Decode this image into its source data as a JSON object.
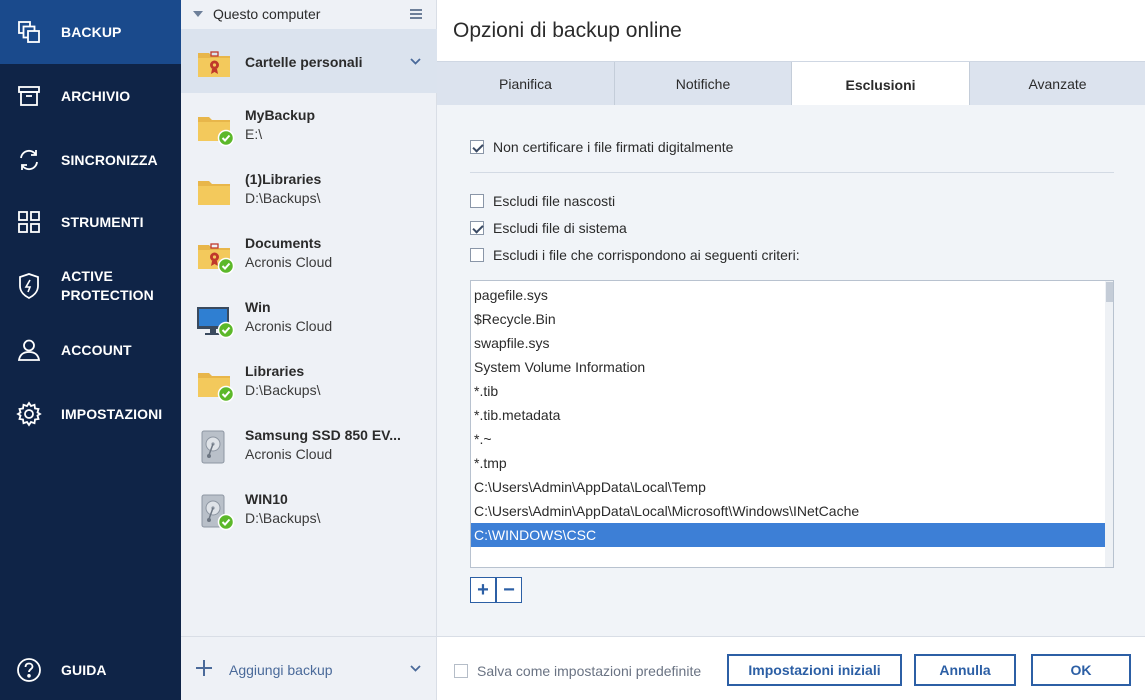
{
  "nav": {
    "items": [
      {
        "label": "BACKUP",
        "icon": "backup-icon"
      },
      {
        "label": "ARCHIVIO",
        "icon": "archive-icon"
      },
      {
        "label": "SINCRONIZZA",
        "icon": "sync-icon"
      },
      {
        "label": "STRUMENTI",
        "icon": "tools-grid-icon"
      },
      {
        "label": "ACTIVE\nPROTECTION",
        "icon": "shield-icon"
      },
      {
        "label": "ACCOUNT",
        "icon": "user-icon"
      },
      {
        "label": "IMPOSTAZIONI",
        "icon": "gear-icon"
      }
    ],
    "help": {
      "label": "GUIDA",
      "icon": "help-icon"
    }
  },
  "sources": {
    "header": "Questo computer",
    "items": [
      {
        "name": "Cartelle personali",
        "location": "",
        "icon": "personal-folder-icon",
        "status": "none"
      },
      {
        "name": "MyBackup",
        "location": "E:\\",
        "icon": "folder-icon",
        "status": "ok"
      },
      {
        "name": "(1)Libraries",
        "location": "D:\\Backups\\",
        "icon": "folder-icon",
        "status": "none"
      },
      {
        "name": "Documents",
        "location": "Acronis Cloud",
        "icon": "personal-folder-icon",
        "status": "ok"
      },
      {
        "name": "Win",
        "location": "Acronis Cloud",
        "icon": "monitor-icon",
        "status": "ok"
      },
      {
        "name": "Libraries",
        "location": "D:\\Backups\\",
        "icon": "folder-icon",
        "status": "ok"
      },
      {
        "name": "Samsung SSD 850 EV...",
        "location": "Acronis Cloud",
        "icon": "disk-icon",
        "status": "none"
      },
      {
        "name": "WIN10",
        "location": "D:\\Backups\\",
        "icon": "disk-icon",
        "status": "ok"
      }
    ],
    "add_backup": "Aggiungi backup"
  },
  "dialog": {
    "title": "Opzioni di backup online",
    "tabs": [
      "Pianifica",
      "Notifiche",
      "Esclusioni",
      "Avanzate"
    ],
    "active_tab": "Esclusioni",
    "options": {
      "no_certify": {
        "label": "Non certificare i file firmati digitalmente",
        "checked": true
      },
      "exclude_hidden": {
        "label": "Escludi file nascosti",
        "checked": false
      },
      "exclude_system": {
        "label": "Escludi file di sistema",
        "checked": true
      },
      "exclude_criteria": {
        "label": "Escludi i file che corrispondono ai seguenti criteri:",
        "checked": false
      }
    },
    "exclusions": [
      "pagefile.sys",
      "$Recycle.Bin",
      "swapfile.sys",
      "System Volume Information",
      "*.tib",
      "*.tib.metadata",
      "*.~",
      "*.tmp",
      "C:\\Users\\Admin\\AppData\\Local\\Temp",
      "C:\\Users\\Admin\\AppData\\Local\\Microsoft\\Windows\\INetCache",
      "C:\\WINDOWS\\CSC"
    ],
    "selected_exclusion": "C:\\WINDOWS\\CSC",
    "add_symbol": "+",
    "remove_symbol": "−",
    "save_default": {
      "label": "Salva come impostazioni predefinite",
      "checked": false
    },
    "buttons": {
      "reset": "Impostazioni iniziali",
      "cancel": "Annulla",
      "ok": "OK"
    }
  },
  "colors": {
    "nav_bg": "#0f2447",
    "nav_active": "#1a4a8c",
    "accent": "#2c5fa5",
    "selection": "#3d7fd6",
    "status_ok": "#5cb82a"
  }
}
